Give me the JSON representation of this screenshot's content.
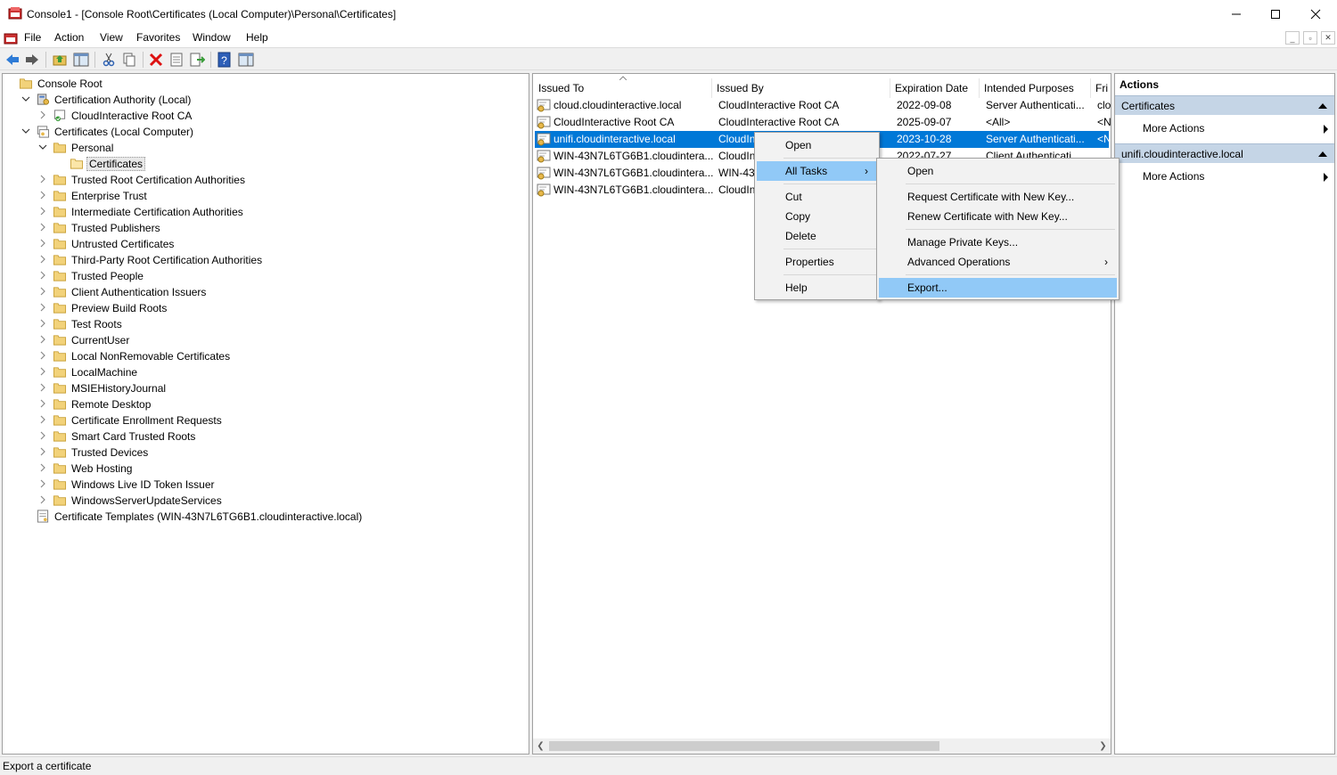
{
  "window": {
    "title": "Console1 - [Console Root\\Certificates (Local Computer)\\Personal\\Certificates]"
  },
  "menu": [
    "File",
    "Action",
    "View",
    "Favorites",
    "Window",
    "Help"
  ],
  "tree": [
    {
      "label": "Console Root",
      "icon": "folder-icon"
    },
    {
      "label": "Certification Authority (Local)",
      "icon": "ca-server-icon"
    },
    {
      "label": "CloudInteractive Root CA",
      "icon": "ca-cert-icon"
    },
    {
      "label": "Certificates (Local Computer)",
      "icon": "cert-store-icon"
    },
    {
      "label": "Personal",
      "icon": "folder-icon"
    },
    {
      "label": "Certificates",
      "icon": "folder-open-icon"
    },
    {
      "label": "Trusted Root Certification Authorities",
      "icon": "folder-icon"
    },
    {
      "label": "Enterprise Trust",
      "icon": "folder-icon"
    },
    {
      "label": "Intermediate Certification Authorities",
      "icon": "folder-icon"
    },
    {
      "label": "Trusted Publishers",
      "icon": "folder-icon"
    },
    {
      "label": "Untrusted Certificates",
      "icon": "folder-icon"
    },
    {
      "label": "Third-Party Root Certification Authorities",
      "icon": "folder-icon"
    },
    {
      "label": "Trusted People",
      "icon": "folder-icon"
    },
    {
      "label": "Client Authentication Issuers",
      "icon": "folder-icon"
    },
    {
      "label": "Preview Build Roots",
      "icon": "folder-icon"
    },
    {
      "label": "Test Roots",
      "icon": "folder-icon"
    },
    {
      "label": "CurrentUser",
      "icon": "folder-icon"
    },
    {
      "label": "Local NonRemovable Certificates",
      "icon": "folder-icon"
    },
    {
      "label": "LocalMachine",
      "icon": "folder-icon"
    },
    {
      "label": "MSIEHistoryJournal",
      "icon": "folder-icon"
    },
    {
      "label": "Remote Desktop",
      "icon": "folder-icon"
    },
    {
      "label": "Certificate Enrollment Requests",
      "icon": "folder-icon"
    },
    {
      "label": "Smart Card Trusted Roots",
      "icon": "folder-icon"
    },
    {
      "label": "Trusted Devices",
      "icon": "folder-icon"
    },
    {
      "label": "Web Hosting",
      "icon": "folder-icon"
    },
    {
      "label": "Windows Live ID Token Issuer",
      "icon": "folder-icon"
    },
    {
      "label": "WindowsServerUpdateServices",
      "icon": "folder-icon"
    },
    {
      "label": "Certificate Templates (WIN-43N7L6TG6B1.cloudinteractive.local)",
      "icon": "template-icon"
    }
  ],
  "list": {
    "columns": [
      "Issued To",
      "Issued By",
      "Expiration Date",
      "Intended Purposes",
      "Fri"
    ],
    "rows": [
      {
        "issued_to": "cloud.cloudinteractive.local",
        "issued_by": "CloudInteractive Root CA",
        "expiration": "2022-09-08",
        "purposes": "Server Authenticati...",
        "friendly": "clo"
      },
      {
        "issued_to": "CloudInteractive Root CA",
        "issued_by": "CloudInteractive Root CA",
        "expiration": "2025-09-07",
        "purposes": "<All>",
        "friendly": "<N"
      },
      {
        "issued_to": "unifi.cloudinteractive.local",
        "issued_by": "CloudIn",
        "expiration": "2023-10-28",
        "purposes": "Server Authenticati...",
        "friendly": "<N"
      },
      {
        "issued_to": "WIN-43N7L6TG6B1.cloudintera...",
        "issued_by": "CloudIn",
        "expiration": "2022-07-27",
        "purposes": "Client Authenticati...",
        "friendly": ""
      },
      {
        "issued_to": "WIN-43N7L6TG6B1.cloudintera...",
        "issued_by": "WIN-43I",
        "expiration": "",
        "purposes": "",
        "friendly": ""
      },
      {
        "issued_to": "WIN-43N7L6TG6B1.cloudintera...",
        "issued_by": "CloudIn",
        "expiration": "",
        "purposes": "",
        "friendly": ""
      }
    ]
  },
  "context_menu": {
    "items": [
      "Open",
      "All Tasks",
      "Cut",
      "Copy",
      "Delete",
      "Properties",
      "Help"
    ]
  },
  "submenu": {
    "items": [
      "Open",
      "Request Certificate with New Key...",
      "Renew Certificate with New Key...",
      "Manage Private Keys...",
      "Advanced Operations",
      "Export..."
    ]
  },
  "actions": {
    "header": "Actions",
    "sections": [
      {
        "title": "Certificates",
        "item": "More Actions"
      },
      {
        "title": "unifi.cloudinteractive.local",
        "item": "More Actions"
      }
    ]
  },
  "status": "Export a certificate",
  "colors": {
    "selection": "#0078d7",
    "menu_highlight": "#91c9f7",
    "action_section": "#c5d5e6"
  }
}
